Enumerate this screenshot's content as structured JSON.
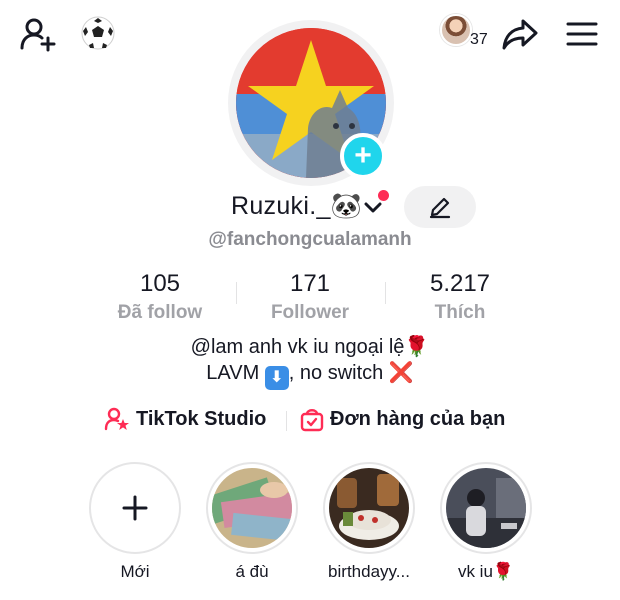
{
  "topbar": {
    "add_friend_icon": "person-add-icon",
    "ball_icon": "soccer-ball-icon",
    "viewer_count": "37",
    "share_icon": "share-arrow-icon",
    "menu_icon": "hamburger-menu-icon"
  },
  "profile": {
    "display_name": "Ruzuki._🐼",
    "username": "@fanchongcualamanh"
  },
  "stats": [
    {
      "value": "105",
      "label": "Đã follow"
    },
    {
      "value": "171",
      "label": "Follower"
    },
    {
      "value": "5.217",
      "label": "Thích"
    }
  ],
  "bio": {
    "line1": "@lam anh vk iu ngoại lệ",
    "line1_emoji": "🌹",
    "line2_a": "LAVM",
    "line2_arrow": "⬇",
    "line2_b": ", no switch",
    "line2_x": "❌"
  },
  "links": {
    "studio": "TikTok Studio",
    "orders": "Đơn hàng của bạn"
  },
  "highlights": [
    {
      "label": "Mới"
    },
    {
      "label": "á đù"
    },
    {
      "label": "birthdayy..."
    },
    {
      "label": "vk iu🌹"
    }
  ],
  "colors": {
    "accent": "#fe2c55",
    "plus_badge": "#20d5ec",
    "muted_text": "#8a8b91"
  }
}
